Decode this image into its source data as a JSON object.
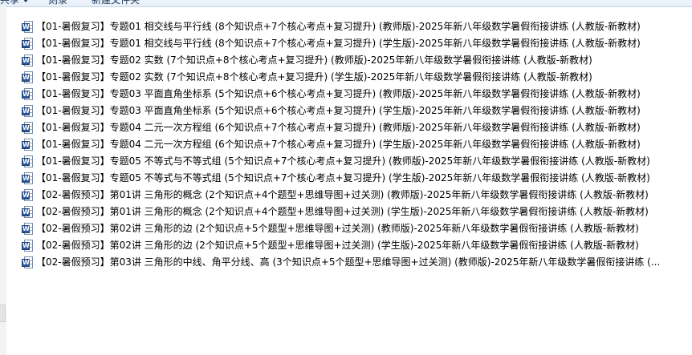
{
  "toolbar": {
    "share_label": "共享",
    "burn_label": "刻录",
    "new_folder_label": "新建文件夹"
  },
  "file_icon": "word-doc-icon",
  "file_icon_letter": "W",
  "files": [
    {
      "name": "【01-暑假复习】专题01 相交线与平行线 (8个知识点+7个核心考点+复习提升) (教师版)-2025年新八年级数学暑假衔接讲练 (人教版-新教材)"
    },
    {
      "name": "【01-暑假复习】专题01 相交线与平行线 (8个知识点+7个核心考点+复习提升) (学生版)-2025年新八年级数学暑假衔接讲练 (人教版-新教材)"
    },
    {
      "name": "【01-暑假复习】专题02 实数 (7个知识点+8个核心考点+复习提升) (教师版)-2025年新八年级数学暑假衔接讲练 (人教版-新教材)"
    },
    {
      "name": "【01-暑假复习】专题02 实数 (7个知识点+8个核心考点+复习提升) (学生版)-2025年新八年级数学暑假衔接讲练 (人教版-新教材)"
    },
    {
      "name": "【01-暑假复习】专题03 平面直角坐标系 (5个知识点+6个核心考点+复习提升) (教师版)-2025年新八年级数学暑假衔接讲练 (人教版-新教材)"
    },
    {
      "name": "【01-暑假复习】专题03 平面直角坐标系 (5个知识点+6个核心考点+复习提升) (学生版)-2025年新八年级数学暑假衔接讲练 (人教版-新教材)"
    },
    {
      "name": "【01-暑假复习】专题04 二元一次方程组 (6个知识点+7个核心考点+复习提升) (教师版)-2025年新八年级数学暑假衔接讲练 (人教版-新教材)"
    },
    {
      "name": "【01-暑假复习】专题04 二元一次方程组 (6个知识点+7个核心考点+复习提升) (学生版)-2025年新八年级数学暑假衔接讲练 (人教版-新教材)"
    },
    {
      "name": "【01-暑假复习】专题05 不等式与不等式组 (5个知识点+7个核心考点+复习提升) (教师版)-2025年新八年级数学暑假衔接讲练 (人教版-新教材)"
    },
    {
      "name": "【01-暑假复习】专题05 不等式与不等式组 (5个知识点+7个核心考点+复习提升) (学生版)-2025年新八年级数学暑假衔接讲练 (人教版-新教材)"
    },
    {
      "name": "【02-暑假预习】第01讲 三角形的概念 (2个知识点+4个题型+思维导图+过关测) (教师版)-2025年新八年级数学暑假衔接讲练 (人教版-新教材)"
    },
    {
      "name": "【02-暑假预习】第01讲 三角形的概念 (2个知识点+4个题型+思维导图+过关测) (学生版)-2025年新八年级数学暑假衔接讲练 (人教版-新教材)"
    },
    {
      "name": "【02-暑假预习】第02讲 三角形的边 (2个知识点+5个题型+思维导图+过关测) (教师版)-2025年新八年级数学暑假衔接讲练 (人教版-新教材)"
    },
    {
      "name": "【02-暑假预习】第02讲 三角形的边 (2个知识点+5个题型+思维导图+过关测) (学生版)-2025年新八年级数学暑假衔接讲练 (人教版-新教材)"
    },
    {
      "name": "【02-暑假预习】第03讲 三角形的中线、角平分线、高 (3个知识点+5个题型+思维导图+过关测) (教师版)-2025年新八年级数学暑假衔接讲练 (..."
    }
  ]
}
